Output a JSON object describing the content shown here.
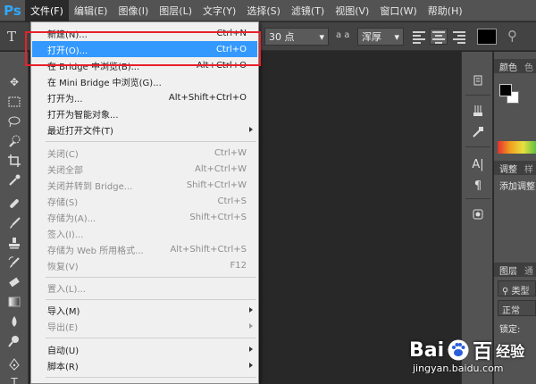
{
  "app": {
    "logo": "Ps"
  },
  "menubar": {
    "items": [
      "文件(F)",
      "编辑(E)",
      "图像(I)",
      "图层(L)",
      "文字(Y)",
      "选择(S)",
      "滤镜(T)",
      "视图(V)",
      "窗口(W)",
      "帮助(H)"
    ],
    "active_index": 0
  },
  "options": {
    "tool_glyph": "T",
    "font_size": "30 点",
    "aa_icon": "a a",
    "aa_mode": "浑厚"
  },
  "file_menu": {
    "items": [
      {
        "label": "新建(N)...",
        "shortcut": "Ctrl+N"
      },
      {
        "label": "打开(O)...",
        "shortcut": "Ctrl+O",
        "highlighted": true
      },
      {
        "label": "在 Bridge 中浏览(B)...",
        "shortcut": "Alt+Ctrl+O"
      },
      {
        "label": "在 Mini Bridge 中浏览(G)...",
        "shortcut": ""
      },
      {
        "label": "打开为...",
        "shortcut": "Alt+Shift+Ctrl+O"
      },
      {
        "label": "打开为智能对象...",
        "shortcut": ""
      },
      {
        "label": "最近打开文件(T)",
        "shortcut": "",
        "submenu": true
      },
      {
        "label": "关闭(C)",
        "shortcut": "Ctrl+W",
        "disabled": true
      },
      {
        "label": "关闭全部",
        "shortcut": "Alt+Ctrl+W",
        "disabled": true
      },
      {
        "label": "关闭并转到 Bridge...",
        "shortcut": "Shift+Ctrl+W",
        "disabled": true
      },
      {
        "label": "存储(S)",
        "shortcut": "Ctrl+S",
        "disabled": true
      },
      {
        "label": "存储为(A)...",
        "shortcut": "Shift+Ctrl+S",
        "disabled": true
      },
      {
        "label": "签入(I)...",
        "shortcut": "",
        "disabled": true
      },
      {
        "label": "存储为 Web 所用格式...",
        "shortcut": "Alt+Shift+Ctrl+S",
        "disabled": true
      },
      {
        "label": "恢复(V)",
        "shortcut": "F12",
        "disabled": true
      },
      {
        "label": "置入(L)...",
        "shortcut": "",
        "disabled": true
      },
      {
        "label": "导入(M)",
        "shortcut": "",
        "submenu": true
      },
      {
        "label": "导出(E)",
        "shortcut": "",
        "submenu": true,
        "disabled": true
      },
      {
        "label": "自动(U)",
        "shortcut": "",
        "submenu": true
      },
      {
        "label": "脚本(R)",
        "shortcut": "",
        "submenu": true
      }
    ]
  },
  "right_panel": {
    "color_tab": "颜色",
    "color_tab2": "色",
    "adjust_tab": "调整",
    "adjust_tab2": "样",
    "adjust_text": "添加调整",
    "layers_tab": "图层",
    "layers_tab2": "通",
    "kind_label": "类型",
    "blend_mode": "正常",
    "lock_label": "锁定:"
  },
  "watermark": {
    "brand_a": "Bai",
    "brand_b": "百",
    "product": "经验",
    "url": "jingyan.baidu.com"
  },
  "colors": {
    "highlight": "#3399ff",
    "annotation": "#e8202a",
    "ps_blue": "#31a8ff"
  },
  "icons": [
    "move-icon",
    "marquee-icon",
    "lasso-icon",
    "quick-select-icon",
    "crop-icon",
    "eyedropper-icon",
    "healing-icon",
    "brush-icon",
    "stamp-icon",
    "history-brush-icon",
    "eraser-icon",
    "gradient-icon",
    "blur-icon",
    "dodge-icon",
    "pen-icon",
    "type-icon"
  ]
}
